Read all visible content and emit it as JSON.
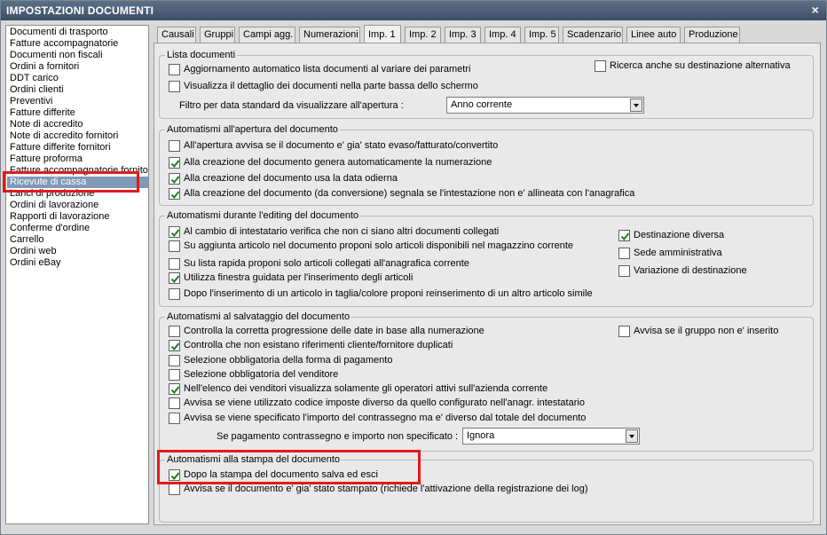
{
  "window": {
    "title": "IMPOSTAZIONI DOCUMENTI",
    "close_glyph": "×"
  },
  "doclist": {
    "items": [
      "Documenti di trasporto",
      "Fatture accompagnatorie",
      "Documenti non fiscali",
      "Ordini a fornitori",
      "DDT carico",
      "Ordini clienti",
      "Preventivi",
      "Fatture differite",
      "Note di accredito",
      "Note di accredito fornitori",
      "Fatture differite fornitori",
      "Fatture proforma",
      "Fatture accompagnatorie fornito",
      "Ricevute di cassa",
      "Lanci di produzione",
      "Ordini di lavorazione",
      "Rapporti di lavorazione",
      "Conferme d'ordine",
      "Carrello",
      "Ordini web",
      "Ordini eBay"
    ],
    "selected": "Ricevute di cassa"
  },
  "tabs": [
    "Causali",
    "Gruppi",
    "Campi agg.",
    "Numerazioni",
    "Imp. 1",
    "Imp. 2",
    "Imp. 3",
    "Imp. 4",
    "Imp. 5",
    "Scadenzario",
    "Linee auto",
    "Produzione"
  ],
  "active_tab": "Imp. 1",
  "groups": {
    "lista": {
      "title": "Lista documenti",
      "items": [
        {
          "label": "Aggiornamento automatico lista documenti al variare dei parametri",
          "checked": false
        },
        {
          "label": "Visualizza il dettaglio dei documenti nella parte bassa dello schermo",
          "checked": false
        },
        {
          "label": "Ricerca anche su destinazione alternativa",
          "checked": false
        }
      ],
      "filter_label": "Filtro per data standard da visualizzare all'apertura :",
      "filter_value": "Anno corrente"
    },
    "apertura": {
      "title": "Automatismi all'apertura del documento",
      "items": [
        {
          "label": "All'apertura avvisa se il documento e' gia' stato evaso/fatturato/convertito",
          "checked": false
        },
        {
          "label": "Alla creazione del documento genera automaticamente la numerazione",
          "checked": true
        },
        {
          "label": "Alla creazione del documento usa la data odierna",
          "checked": true
        },
        {
          "label": "Alla creazione del documento (da conversione) segnala se l'intestazione non e' allineata con l'anagrafica",
          "checked": true
        }
      ]
    },
    "editing": {
      "title": "Automatismi durante l'editing del documento",
      "items": [
        {
          "label": "Al cambio di intestatario verifica che non ci siano altri documenti collegati",
          "checked": true
        },
        {
          "label": "Su aggiunta articolo nel documento proponi solo articoli disponibili nel magazzino corrente",
          "checked": false
        },
        {
          "label": "Su lista rapida proponi solo articoli collegati all'anagrafica corrente",
          "checked": false
        },
        {
          "label": "Utilizza finestra guidata per l'inserimento degli articoli",
          "checked": true
        },
        {
          "label": "Dopo l'inserimento di un articolo in taglia/colore proponi reinserimento di un altro articolo simile",
          "checked": false
        },
        {
          "label": "Destinazione diversa",
          "checked": true
        },
        {
          "label": "Sede amministrativa",
          "checked": false
        },
        {
          "label": "Variazione di destinazione",
          "checked": false
        }
      ]
    },
    "salvataggio": {
      "title": "Automatismi al salvataggio del documento",
      "items": [
        {
          "label": "Controlla la corretta progressione delle date in base alla numerazione",
          "checked": false
        },
        {
          "label": "Controlla che non esistano riferimenti cliente/fornitore duplicati",
          "checked": true
        },
        {
          "label": "Selezione obbligatoria della forma di pagamento",
          "checked": false
        },
        {
          "label": "Selezione obbligatoria del venditore",
          "checked": false
        },
        {
          "label": "Nell'elenco dei venditori visualizza solamente gli operatori attivi sull'azienda corrente",
          "checked": true
        },
        {
          "label": "Avvisa se viene utilizzato codice imposte diverso da quello configurato nell'anagr. intestatario",
          "checked": false
        },
        {
          "label": "Avvisa se viene specificato l'importo del contrassegno ma e' diverso dal totale del documento",
          "checked": false
        },
        {
          "label": "Avvisa se il gruppo non e' inserito",
          "checked": false
        }
      ],
      "contrassegno_label": "Se pagamento contrassegno e importo non specificato :",
      "contrassegno_value": "Ignora"
    },
    "stampa": {
      "title": "Automatismi alla stampa del documento",
      "items": [
        {
          "label": "Dopo la stampa del documento salva ed esci",
          "checked": true
        },
        {
          "label": "Avvisa se il documento e' gia' stato stampato (richiede l'attivazione della registrazione dei log)",
          "checked": false
        }
      ]
    }
  },
  "colors": {
    "highlight": "#e21a1a",
    "selection": "#7f9ab8",
    "titlebar": "#4a5b73"
  }
}
